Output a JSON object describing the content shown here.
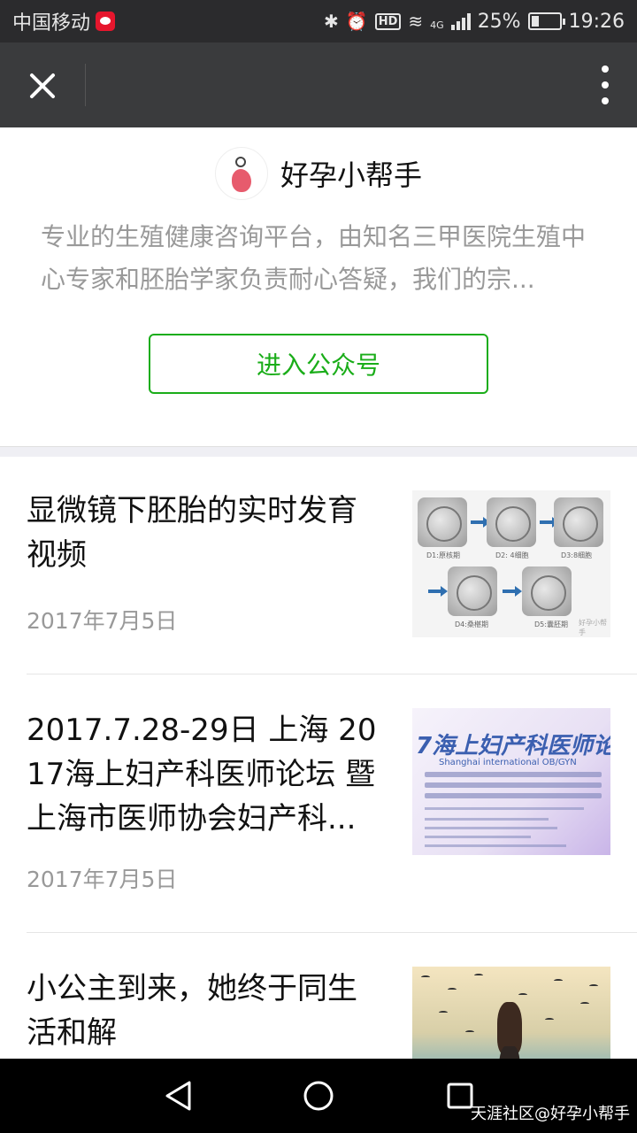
{
  "status_bar": {
    "carrier": "中国移动",
    "network": "4G",
    "battery": "25%",
    "time": "19:26",
    "hd_badge": "HD"
  },
  "nav": {
    "close_icon": "close-icon",
    "more_icon": "more-vertical-icon"
  },
  "profile": {
    "name": "好孕小帮手",
    "description": "专业的生殖健康咨询平台，由知名三甲医院生殖中心专家和胚胎学家负责耐心答疑，我们的宗...",
    "follow_button": "进入公众号"
  },
  "articles": [
    {
      "title": "显微镜下胚胎的实时发育视频",
      "date": "2017年7月5日",
      "thumb_labels": [
        "D1:原核期",
        "D2: 4细胞",
        "D3:8细胞",
        "D4:桑椹期",
        "D5:囊胚期"
      ],
      "thumb_watermark": "好孕小帮手"
    },
    {
      "title": "2017.7.28-29日 上海 2017海上妇产科医师论坛 暨上海市医师协会妇产科...",
      "date": "2017年7月5日",
      "thumb_heading": "7海上妇产科医师论",
      "thumb_subheading": "Shanghai international OB/GYN"
    },
    {
      "title": "小公主到来，她终于同生活和解",
      "date": ""
    }
  ],
  "bottom_nav": {
    "back_icon": "back-triangle-icon",
    "home_icon": "home-circle-icon",
    "recent_icon": "recent-square-icon"
  },
  "watermark": "天涯社区@好孕小帮手",
  "colors": {
    "accent": "#1aad19",
    "status_bar": "#2b2b2d",
    "nav_bar": "#3a3b3d"
  }
}
